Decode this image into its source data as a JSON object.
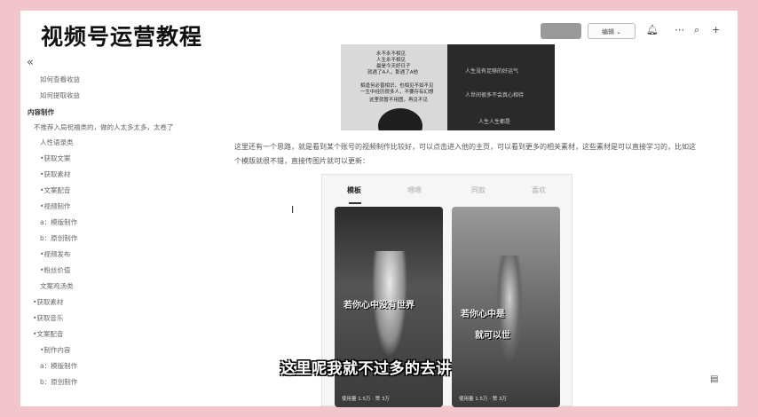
{
  "overlay_title": "视频号运营教程",
  "toolbar": {
    "share_label": "",
    "edit_label": "编辑 ⌄",
    "bell_icon": "bell-icon",
    "search_icon": "search-icon",
    "add_icon": "plus-icon"
  },
  "sidebar": {
    "collapse_glyph": "«",
    "items": [
      {
        "label": "如何查看收益",
        "indent": 2,
        "dark": false
      },
      {
        "label": "如何提取收益",
        "indent": 2,
        "dark": false
      },
      {
        "label": "内容制作",
        "indent": 0,
        "dark": true
      },
      {
        "label": "不推荐入局祝福类的，做的人太多太多，太卷了",
        "indent": 1,
        "dark": false
      },
      {
        "label": "人性语录类",
        "indent": 2,
        "dark": false
      },
      {
        "label": "•获取文案",
        "indent": 2,
        "dark": false
      },
      {
        "label": "•获取素材",
        "indent": 2,
        "dark": false
      },
      {
        "label": "•文案配音",
        "indent": 2,
        "dark": false
      },
      {
        "label": "•视频制作",
        "indent": 2,
        "dark": false
      },
      {
        "label": "a：模版制作",
        "indent": 2,
        "dark": false
      },
      {
        "label": "b：原创制作",
        "indent": 2,
        "dark": false
      },
      {
        "label": "•视频发布",
        "indent": 2,
        "dark": false
      },
      {
        "label": "•粉丝价值",
        "indent": 2,
        "dark": false
      },
      {
        "label": "文案鸡汤类",
        "indent": 2,
        "dark": false
      },
      {
        "label": "•获取素材",
        "indent": 1,
        "dark": false
      },
      {
        "label": "•获取音乐",
        "indent": 1,
        "dark": false
      },
      {
        "label": "•文案配音",
        "indent": 1,
        "dark": false
      },
      {
        "label": "•制作内容",
        "indent": 2,
        "dark": false
      },
      {
        "label": "a：模版制作",
        "indent": 2,
        "dark": false
      },
      {
        "label": "b：原创制作",
        "indent": 2,
        "dark": false
      }
    ]
  },
  "image1": {
    "left_lines": [
      "永不永不相见",
      "人生永不相见",
      "最是今天好日子",
      "就遇了A人，那遇了A他",
      "",
      "相逢何必曾相识，也相见不如不见",
      "一生中经历很多人，不要存有幻想",
      "这里就暂不用图，再见不见"
    ],
    "right_lines": [
      "人生没有足够的好运气",
      "人也不一定好的",
      "人世间很多不会真心相待",
      "人生没有谁",
      "人生人生都是"
    ]
  },
  "paragraph": "这里还有一个思路，就是看到某个账号的视频制作比较好，可以点击进入他的主页，可以看到更多的相关素材，这些素材是可以直接学习的，比如这个模版就很不错，直接传图片就可以更新：",
  "phone": {
    "tabs": [
      "模板",
      "喂嗯",
      "同款",
      "喜欢"
    ],
    "cards": [
      {
        "caption_line1": "若你心中没有世界",
        "caption_line2": "",
        "stats": "使用量 1.5万  ·  赞 3万"
      },
      {
        "caption_line1": "若你心中是",
        "caption_line2": "就可以世",
        "stats": "使用量 1.5万  ·  赞 3万"
      }
    ]
  },
  "subtitle": "这里呢我就不过多的去讲",
  "colors": {
    "outer_background": "#f2c4cb",
    "page_background": "#ffffff"
  }
}
